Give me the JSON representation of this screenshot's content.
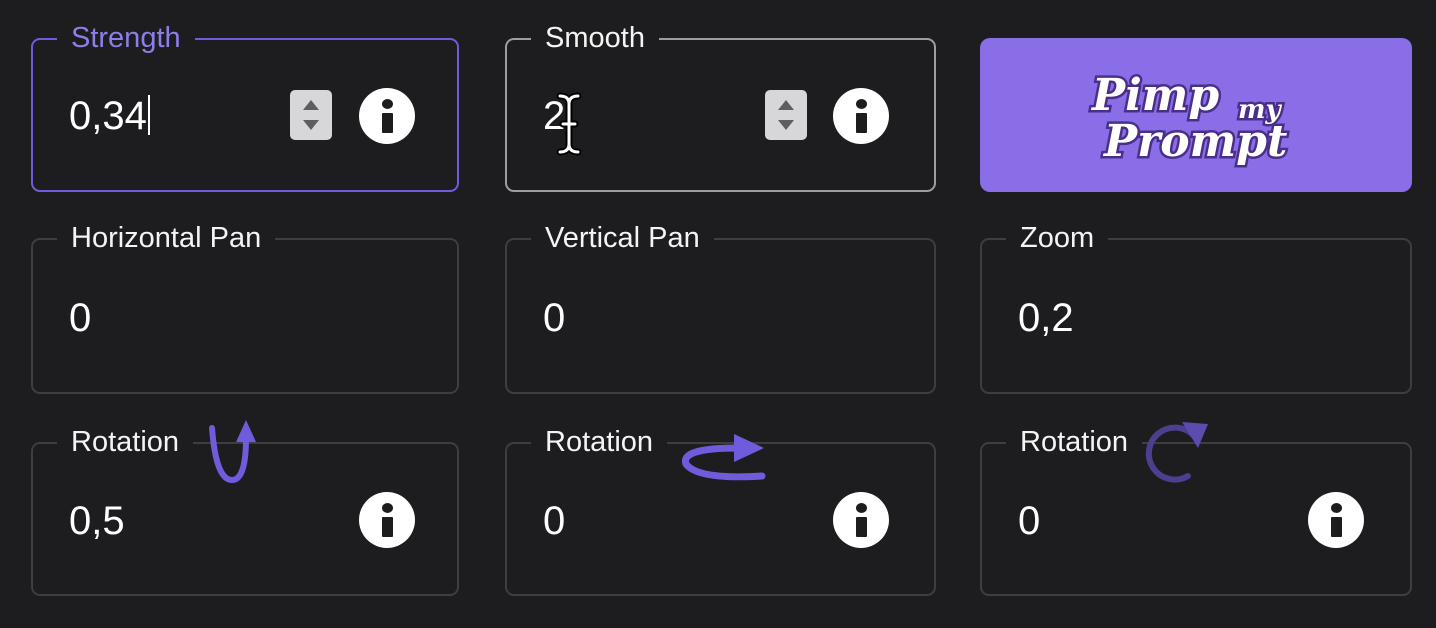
{
  "fields": {
    "strength": {
      "label": "Strength",
      "value": "0,34"
    },
    "smooth": {
      "label": "Smooth",
      "value": "2"
    },
    "horizontal_pan": {
      "label": "Horizontal Pan",
      "value": "0"
    },
    "vertical_pan": {
      "label": "Vertical Pan",
      "value": "0"
    },
    "zoom": {
      "label": "Zoom",
      "value": "0,2"
    },
    "rotation_x": {
      "label": "Rotation",
      "value": "0,5",
      "icon": "rotate-vertical-arrow-icon"
    },
    "rotation_y": {
      "label": "Rotation",
      "value": "0",
      "icon": "rotate-horizontal-arrow-icon"
    },
    "rotation_z": {
      "label": "Rotation",
      "value": "0",
      "icon": "rotate-circular-arrow-icon"
    }
  },
  "pimp_button": {
    "logo_line1": "Pimp",
    "logo_small": "my",
    "logo_line2": "Prompt"
  },
  "colors": {
    "background": "#1d1c1e",
    "accent": "#8a6ee8",
    "active_border": "#6f5cdc",
    "field_border": "#3e3d42",
    "text": "#ffffff"
  }
}
